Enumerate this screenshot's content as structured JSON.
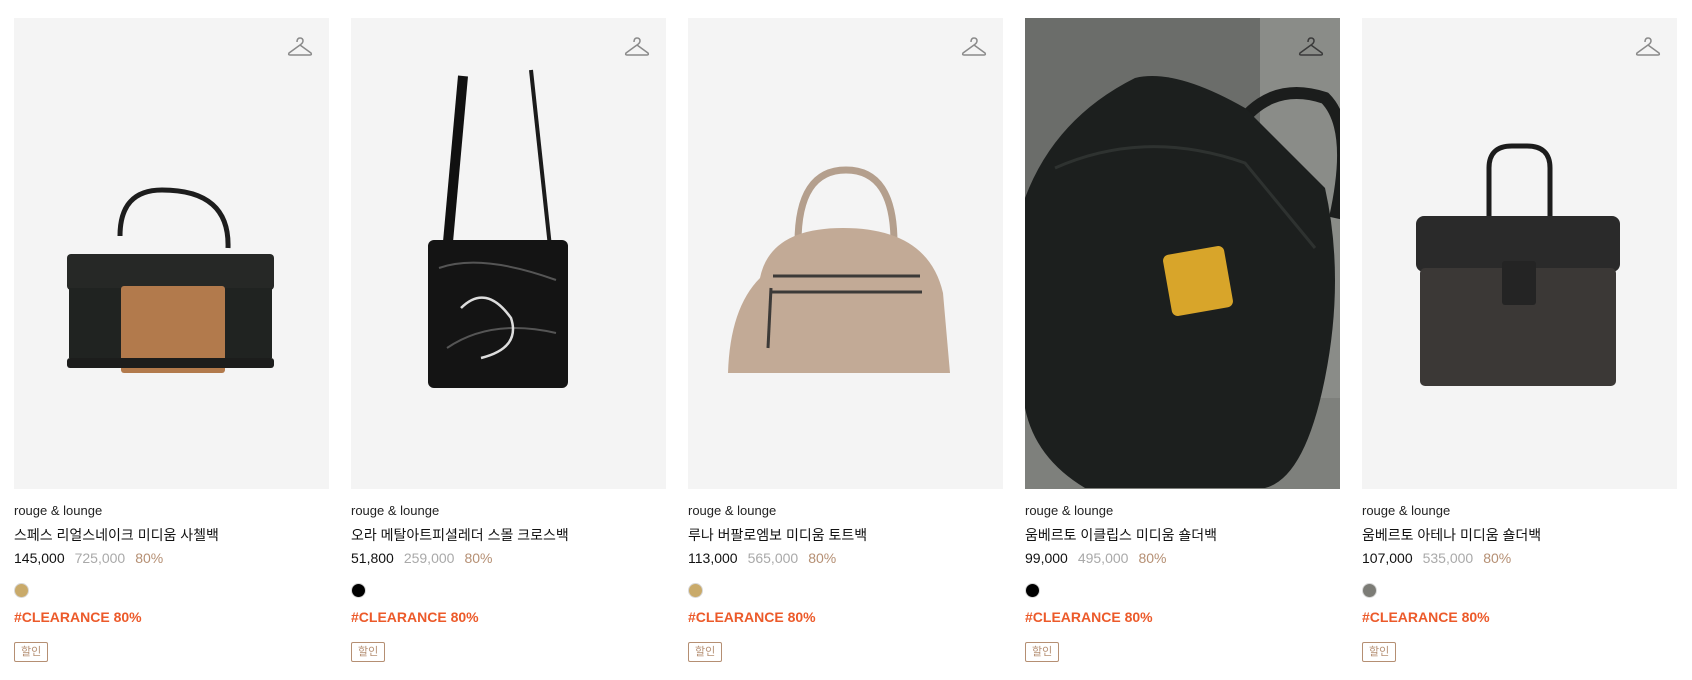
{
  "products": [
    {
      "brand": "rouge & lounge",
      "name": "스페스 리얼스네이크 미디움 사첼백",
      "price": "145,000",
      "original_price": "725,000",
      "discount": "80%",
      "color_swatch": "#c9aa6a",
      "tag": "#CLEARANCE 80%",
      "badge": "할인",
      "icon": "hanger-icon"
    },
    {
      "brand": "rouge & lounge",
      "name": "오라 메탈아트피셜레더 스몰 크로스백",
      "price": "51,800",
      "original_price": "259,000",
      "discount": "80%",
      "color_swatch": "#000000",
      "tag": "#CLEARANCE 80%",
      "badge": "할인",
      "icon": "hanger-icon"
    },
    {
      "brand": "rouge & lounge",
      "name": "루나 버팔로엠보 미디움 토트백",
      "price": "113,000",
      "original_price": "565,000",
      "discount": "80%",
      "color_swatch": "#c9aa6a",
      "tag": "#CLEARANCE 80%",
      "badge": "할인",
      "icon": "hanger-icon"
    },
    {
      "brand": "rouge & lounge",
      "name": "움베르토 이클립스 미디움 숄더백",
      "price": "99,000",
      "original_price": "495,000",
      "discount": "80%",
      "color_swatch": "#000000",
      "tag": "#CLEARANCE 80%",
      "badge": "할인",
      "icon": "hanger-icon"
    },
    {
      "brand": "rouge & lounge",
      "name": "움베르토 아테나 미디움 숄더백",
      "price": "107,000",
      "original_price": "535,000",
      "discount": "80%",
      "color_swatch": "#7c7c76",
      "tag": "#CLEARANCE 80%",
      "badge": "할인",
      "icon": "hanger-icon"
    }
  ],
  "colors": {
    "tag": "#ec5a2a",
    "discount": "#b58f73",
    "original_price": "#a9a9a9",
    "thumb_bg": "#f4f4f4"
  }
}
